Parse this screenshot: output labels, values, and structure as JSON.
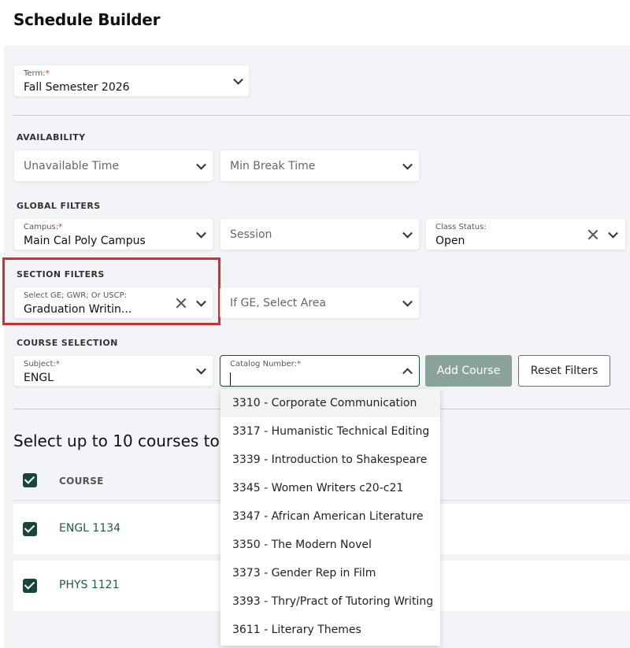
{
  "app": {
    "title": "Schedule Builder"
  },
  "term": {
    "label": "Term:",
    "required": "*",
    "value": "Fall Semester 2026"
  },
  "availability": {
    "heading": "AVAILABILITY",
    "unavailable_time_placeholder": "Unavailable Time",
    "min_break_placeholder": "Min Break Time"
  },
  "global_filters": {
    "heading": "GLOBAL FILTERS",
    "campus": {
      "label": "Campus:",
      "required": "*",
      "value": "Main Cal Poly Campus"
    },
    "session_placeholder": "Session",
    "class_status": {
      "label": "Class Status:",
      "value": "Open"
    }
  },
  "section_filters": {
    "heading": "SECTION FILTERS",
    "ge": {
      "label": "Select GE; GWR; Or USCP:",
      "value": "Graduation Writin..."
    },
    "ge_area_placeholder": "If GE, Select Area"
  },
  "course_selection": {
    "heading": "COURSE SELECTION",
    "subject": {
      "label": "Subject:",
      "required": "*",
      "value": "ENGL"
    },
    "catalog": {
      "label": "Catalog Number:",
      "required": "*",
      "value": ""
    },
    "add_course_label": "Add Course",
    "reset_filters_label": "Reset Filters"
  },
  "catalog_options": [
    "3310 - Corporate Communication",
    "3317 - Humanistic Technical Editing",
    "3339 - Introduction to Shakespeare",
    "3345 - Women Writers c20-c21",
    "3347 - African American Literature",
    "3350 - The Modern Novel",
    "3373 - Gender Rep in Film",
    "3393 - Thry/Pract of Tutoring Writing",
    "3611 - Literary Themes"
  ],
  "courses": {
    "heading": "Select up to 10 courses to b",
    "column_course": "COURSE",
    "rows": [
      {
        "code": "ENGL 1134"
      },
      {
        "code": "PHYS 1121"
      }
    ]
  },
  "colors": {
    "accent": "#17453a",
    "highlight": "#d32f2f",
    "add_button": "#8aa39a"
  },
  "icons": {
    "dropdown": "chevron-down-icon",
    "clear": "close-icon",
    "check": "check-icon"
  }
}
